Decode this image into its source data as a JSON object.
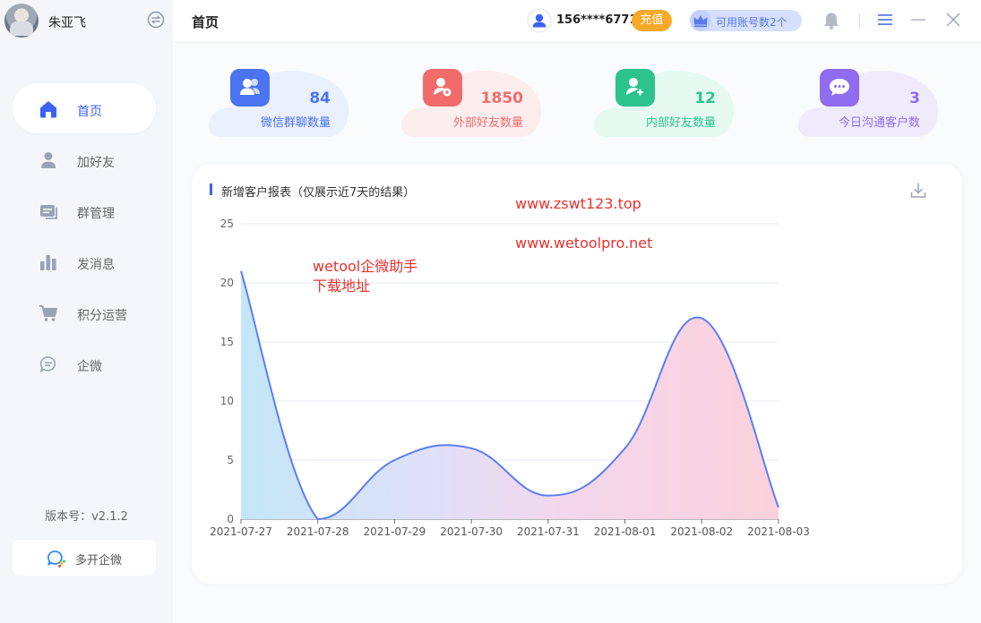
{
  "sidebar": {
    "user_name": "朱亚飞",
    "items": [
      {
        "label": "首页",
        "icon": "home-icon",
        "active": true
      },
      {
        "label": "加好友",
        "icon": "user-icon",
        "active": false
      },
      {
        "label": "群管理",
        "icon": "group-chat-icon",
        "active": false
      },
      {
        "label": "发消息",
        "icon": "bar-chart-icon",
        "active": false
      },
      {
        "label": "积分运营",
        "icon": "cart-icon",
        "active": false
      },
      {
        "label": "企微",
        "icon": "chat-bubble-icon",
        "active": false
      }
    ],
    "version": "版本号：v2.1.2",
    "multi_open_label": "多开企微"
  },
  "header": {
    "title": "首页",
    "phone": "156****6771",
    "recharge_label": "充值",
    "accounts_label": "可用账号数2个"
  },
  "stats": [
    {
      "value": "84",
      "label": "微信群聊数量",
      "color": "#4a74f2",
      "bg": "#eaf0fe"
    },
    {
      "value": "1850",
      "label": "外部好友数量",
      "color": "#f16b6b",
      "bg": "#fdeeee"
    },
    {
      "value": "12",
      "label": "内部好友数量",
      "color": "#2cc38d",
      "bg": "#e6faf2"
    },
    {
      "value": "3",
      "label": "今日沟通客户数",
      "color": "#8f6cf0",
      "bg": "#efebfd"
    }
  ],
  "report": {
    "title": "新增客户报表（仅展示近7天的结果）"
  },
  "overlay": {
    "url1": "www.zswt123.top",
    "url2": "www.wetoolpro.net",
    "line1": "wetool企微助手",
    "line2": "下载地址"
  },
  "chart_data": {
    "type": "area",
    "categories": [
      "2021-07-27",
      "2021-07-28",
      "2021-07-29",
      "2021-07-30",
      "2021-07-31",
      "2021-08-01",
      "2021-08-02",
      "2021-08-03"
    ],
    "values": [
      21,
      0,
      5,
      6,
      2,
      6,
      17,
      1
    ],
    "ylim": [
      0,
      25
    ],
    "yticks": [
      0,
      5,
      10,
      15,
      20,
      25
    ],
    "grid": true,
    "line_color": "#5b7ff2"
  }
}
